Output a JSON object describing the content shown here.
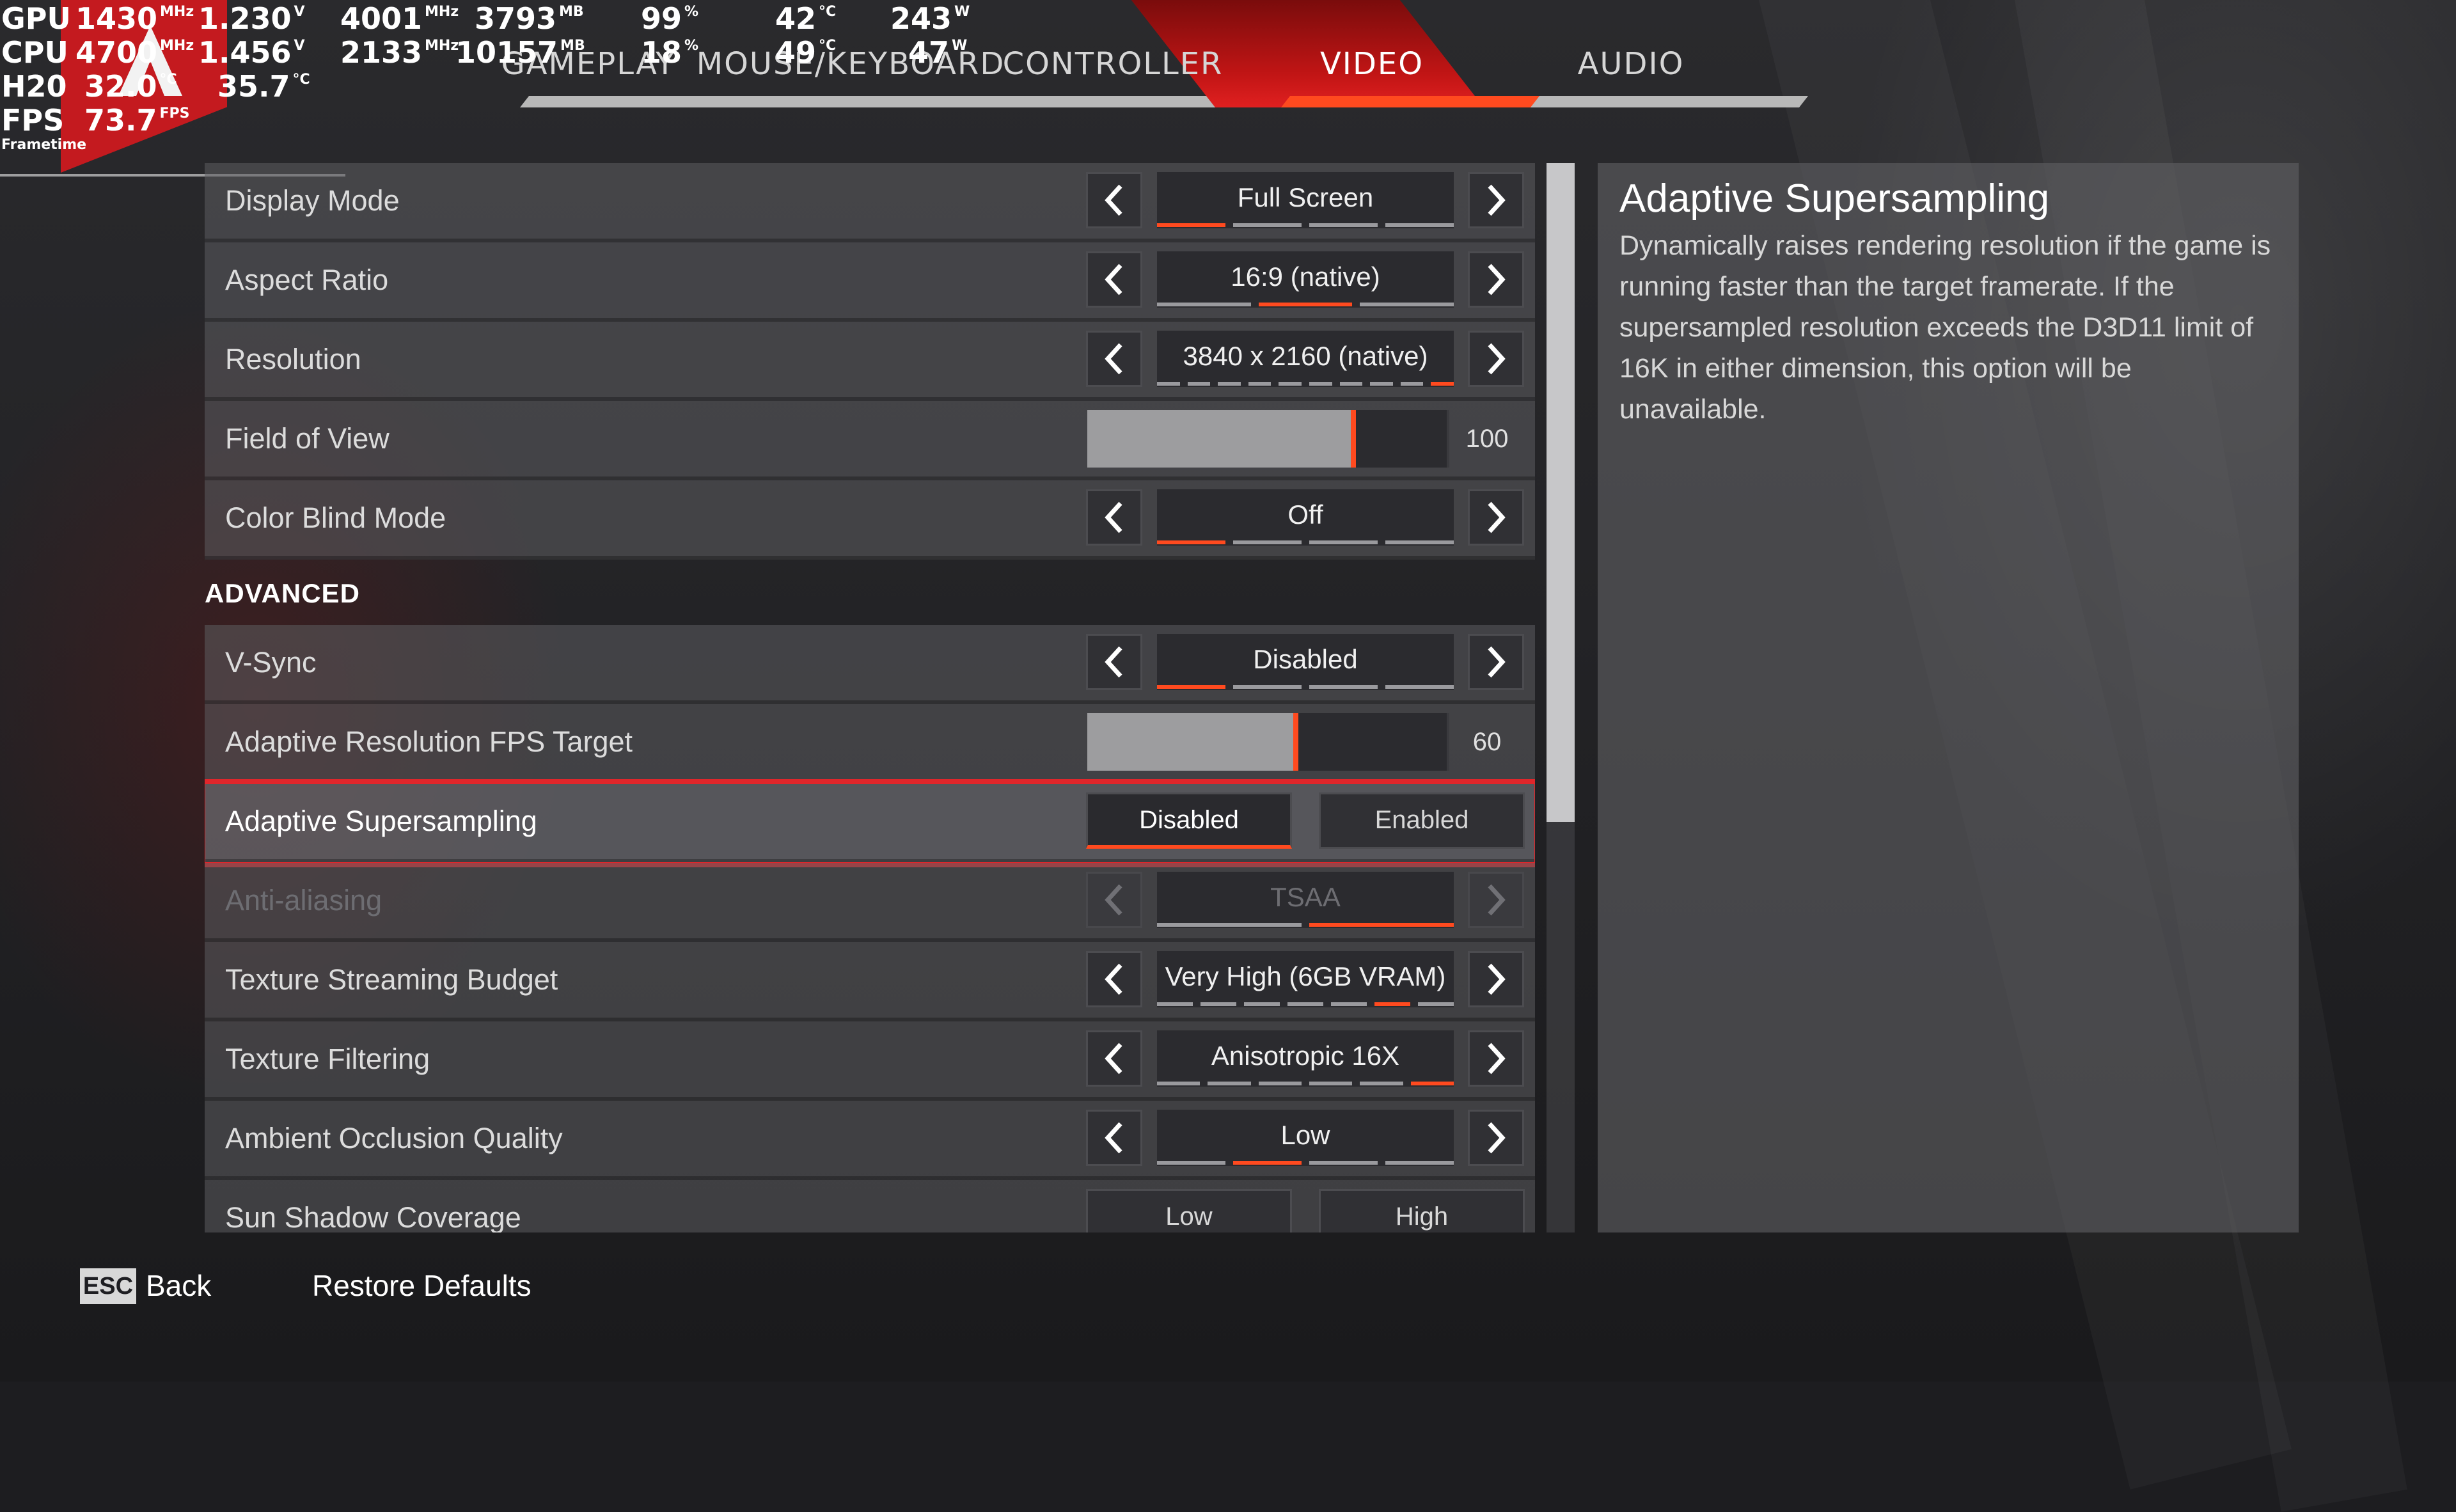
{
  "tabs": [
    {
      "label": "GAMEPLAY",
      "active": false
    },
    {
      "label": "MOUSE/KEYBOARD",
      "active": false
    },
    {
      "label": "CONTROLLER",
      "active": false
    },
    {
      "label": "VIDEO",
      "active": true
    },
    {
      "label": "AUDIO",
      "active": false
    }
  ],
  "overlay": {
    "rows": [
      {
        "label": "GPU",
        "v1": "1430",
        "u1": "MHz",
        "v2": "1.230",
        "u2": "V",
        "v3": "4001",
        "u3": "MHz",
        "v4": "3793",
        "u4": "MB",
        "v5": "99",
        "u5": "%",
        "v6": "42",
        "u6": "°C",
        "v7": "243",
        "u7": "W"
      },
      {
        "label": "CPU",
        "v1": "4700",
        "u1": "MHz",
        "v2": "1.456",
        "u2": "V",
        "v3": "2133",
        "u3": "MHz",
        "v4": "10157",
        "u4": "MB",
        "v5": "18",
        "u5": "%",
        "v6": "49",
        "u6": "°C",
        "v7": "47",
        "u7": "W"
      },
      {
        "label": "H20",
        "v1": "32.0",
        "u1": "°C",
        "v2": "35.7",
        "u2": "°C"
      },
      {
        "label": "FPS",
        "v1": "73.7",
        "u1": "FPS"
      }
    ],
    "frametime_label": "Frametime"
  },
  "settings": {
    "display_mode": {
      "label": "Display Mode",
      "value": "Full Screen",
      "pips": 4,
      "active_pip": 0
    },
    "aspect_ratio": {
      "label": "Aspect Ratio",
      "value": "16:9 (native)",
      "pips": 3,
      "active_pip": 1
    },
    "resolution": {
      "label": "Resolution",
      "value": "3840 x 2160 (native)",
      "pips": 10,
      "active_pip": 9
    },
    "field_of_view": {
      "label": "Field of View",
      "value": "100",
      "fraction": 0.74
    },
    "color_blind_mode": {
      "label": "Color Blind Mode",
      "value": "Off",
      "pips": 4,
      "active_pip": 0
    },
    "advanced_heading": "ADVANCED",
    "vsync": {
      "label": "V-Sync",
      "value": "Disabled",
      "pips": 4,
      "active_pip": 0
    },
    "adaptive_fps_target": {
      "label": "Adaptive Resolution FPS Target",
      "value": "60",
      "fraction": 0.58
    },
    "adaptive_supersampling": {
      "label": "Adaptive Supersampling",
      "option_a": "Disabled",
      "option_b": "Enabled",
      "selected": "Disabled"
    },
    "anti_aliasing": {
      "label": "Anti-aliasing",
      "value": "TSAA",
      "pips": 2,
      "active_pip": 1
    },
    "texture_streaming": {
      "label": "Texture Streaming Budget",
      "value": "Very High (6GB VRAM)",
      "pips": 7,
      "active_pip": 5
    },
    "texture_filtering": {
      "label": "Texture Filtering",
      "value": "Anisotropic 16X",
      "pips": 6,
      "active_pip": 5
    },
    "ambient_occlusion": {
      "label": "Ambient Occlusion Quality",
      "value": "Low",
      "pips": 4,
      "active_pip": 1
    },
    "sun_shadow": {
      "label": "Sun Shadow Coverage",
      "option_a": "Low",
      "option_b": "High"
    }
  },
  "description": {
    "title": "Adaptive Supersampling",
    "body": "Dynamically raises rendering resolution if the game is running faster than the target framerate. If the supersampled resolution exceeds the D3D11 limit of 16K in either dimension, this option will be unavailable."
  },
  "footer": {
    "esc_key": "ESC",
    "back_label": "Back",
    "restore_label": "Restore Defaults"
  },
  "colors": {
    "accent": "#ff4a1f",
    "tab_active": "#c21515",
    "highlight_border": "#e0262b"
  }
}
